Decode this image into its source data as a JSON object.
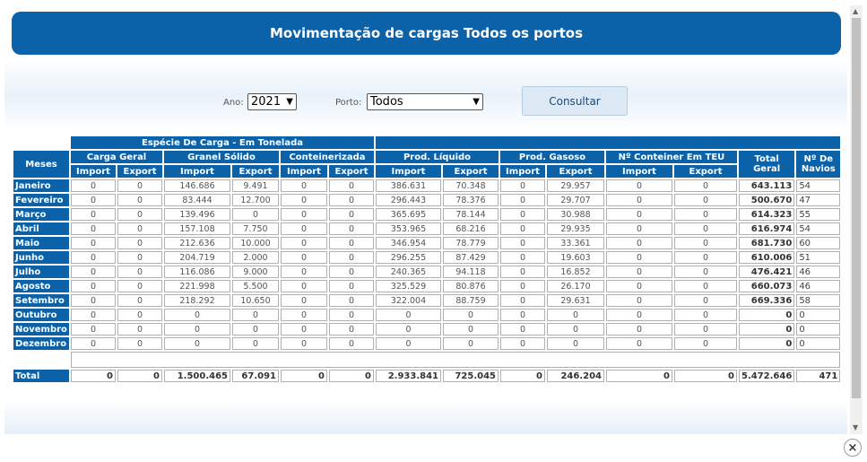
{
  "title": "Movimentação de cargas Todos os portos",
  "filters": {
    "ano_label": "Ano:",
    "ano_value": "2021",
    "porto_label": "Porto:",
    "porto_value": "Todos",
    "consultar_label": "Consultar"
  },
  "table": {
    "group_header": "Espécie De Carga - Em Tonelada",
    "meses_header": "Meses",
    "col_groups": [
      "Carga Geral",
      "Granel Sólido",
      "Conteinerizada",
      "Prod. Líquido",
      "Prod. Gasoso",
      "Nº Conteiner Em TEU"
    ],
    "total_geral": "Total Geral",
    "navios": "Nº De Navios",
    "import": "Import",
    "export": "Export",
    "rows": [
      {
        "mes": "Janeiro",
        "v": [
          "0",
          "0",
          "146.686",
          "9.491",
          "0",
          "0",
          "386.631",
          "70.348",
          "0",
          "29.957",
          "0",
          "0"
        ],
        "total": "643.113",
        "navios": "54"
      },
      {
        "mes": "Fevereiro",
        "v": [
          "0",
          "0",
          "83.444",
          "12.700",
          "0",
          "0",
          "296.443",
          "78.376",
          "0",
          "29.707",
          "0",
          "0"
        ],
        "total": "500.670",
        "navios": "47"
      },
      {
        "mes": "Março",
        "v": [
          "0",
          "0",
          "139.496",
          "0",
          "0",
          "0",
          "365.695",
          "78.144",
          "0",
          "30.988",
          "0",
          "0"
        ],
        "total": "614.323",
        "navios": "55"
      },
      {
        "mes": "Abril",
        "v": [
          "0",
          "0",
          "157.108",
          "7.750",
          "0",
          "0",
          "353.965",
          "68.216",
          "0",
          "29.935",
          "0",
          "0"
        ],
        "total": "616.974",
        "navios": "54"
      },
      {
        "mes": "Maio",
        "v": [
          "0",
          "0",
          "212.636",
          "10.000",
          "0",
          "0",
          "346.954",
          "78.779",
          "0",
          "33.361",
          "0",
          "0"
        ],
        "total": "681.730",
        "navios": "60"
      },
      {
        "mes": "Junho",
        "v": [
          "0",
          "0",
          "204.719",
          "2.000",
          "0",
          "0",
          "296.255",
          "87.429",
          "0",
          "19.603",
          "0",
          "0"
        ],
        "total": "610.006",
        "navios": "51"
      },
      {
        "mes": "Julho",
        "v": [
          "0",
          "0",
          "116.086",
          "9.000",
          "0",
          "0",
          "240.365",
          "94.118",
          "0",
          "16.852",
          "0",
          "0"
        ],
        "total": "476.421",
        "navios": "46"
      },
      {
        "mes": "Agosto",
        "v": [
          "0",
          "0",
          "221.998",
          "5.500",
          "0",
          "0",
          "325.529",
          "80.876",
          "0",
          "26.170",
          "0",
          "0"
        ],
        "total": "660.073",
        "navios": "46"
      },
      {
        "mes": "Setembro",
        "v": [
          "0",
          "0",
          "218.292",
          "10.650",
          "0",
          "0",
          "322.004",
          "88.759",
          "0",
          "29.631",
          "0",
          "0"
        ],
        "total": "669.336",
        "navios": "58"
      },
      {
        "mes": "Outubro",
        "v": [
          "0",
          "0",
          "0",
          "0",
          "0",
          "0",
          "0",
          "0",
          "0",
          "0",
          "0",
          "0"
        ],
        "total": "0",
        "navios": "0"
      },
      {
        "mes": "Novembro",
        "v": [
          "0",
          "0",
          "0",
          "0",
          "0",
          "0",
          "0",
          "0",
          "0",
          "0",
          "0",
          "0"
        ],
        "total": "0",
        "navios": "0"
      },
      {
        "mes": "Dezembro",
        "v": [
          "0",
          "0",
          "0",
          "0",
          "0",
          "0",
          "0",
          "0",
          "0",
          "0",
          "0",
          "0"
        ],
        "total": "0",
        "navios": "0"
      }
    ],
    "total_label": "Total",
    "totals": [
      "0",
      "0",
      "1.500.465",
      "67.091",
      "0",
      "0",
      "2.933.841",
      "725.045",
      "0",
      "246.204",
      "0",
      "0"
    ],
    "total_total": "5.472.646",
    "total_navios": "471"
  },
  "close_label": "×",
  "icons": {
    "close": "close-icon",
    "dropdown": "chevron-down-icon"
  },
  "colors": {
    "accent": "#0c62a8"
  }
}
